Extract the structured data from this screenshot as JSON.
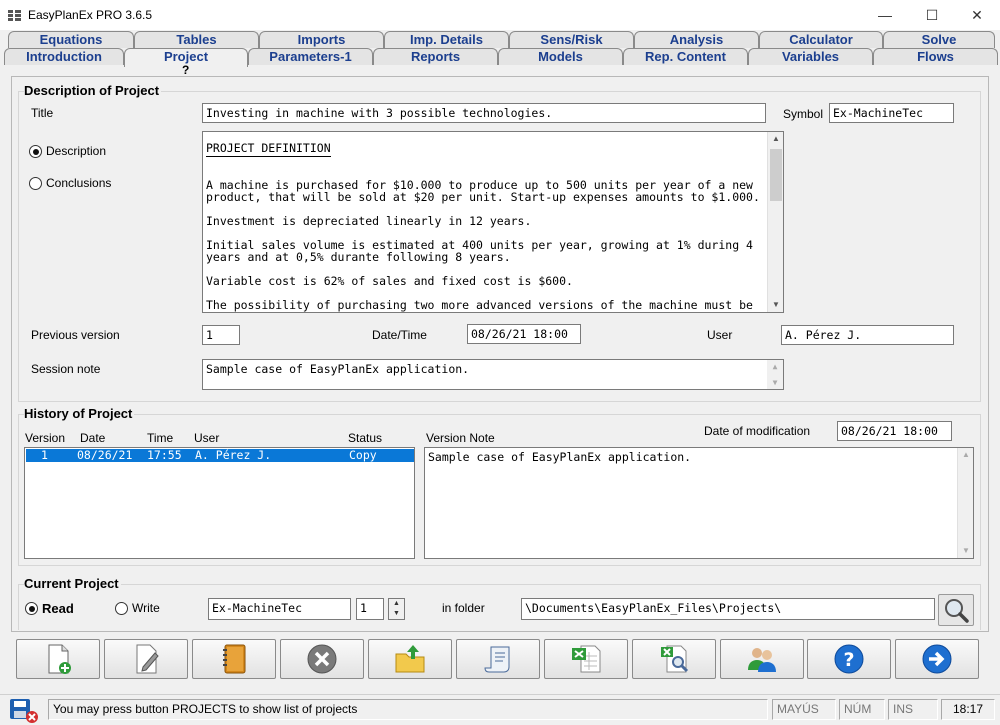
{
  "window": {
    "title": "EasyPlanEx PRO  3.6.5",
    "minimize": "—",
    "maximize": "☐",
    "close": "✕"
  },
  "tabs_row1": [
    "Equations",
    "Tables",
    "Imports",
    "Imp. Details",
    "Sens/Risk",
    "Analysis",
    "Calculator",
    "Solve"
  ],
  "tabs_row2": [
    "Introduction",
    "Project",
    "Parameters-1",
    "Reports",
    "Models",
    "Rep. Content",
    "Variables",
    "Flows"
  ],
  "help_mark": "?",
  "description": {
    "section_title": "Description of Project",
    "title_label": "Title",
    "title_value": "Investing in machine with 3 possible technologies.",
    "symbol_label": "Symbol",
    "symbol_value": "Ex-MachineTec",
    "radio_description": "Description",
    "radio_conclusions": "Conclusions",
    "text_heading": "PROJECT DEFINITION",
    "text_paragraphs": [
      "A machine is purchased for $10.000 to produce up to 500 units per year of a new product, that will be sold at $20 per unit. Start-up expenses amounts to $1.000.",
      "Investment is depreciated linearly in 12 years.",
      "Initial sales volume is estimated at 400 units per year, growing at 1% during 4 years and at 0,5% durante following 8 years.",
      "Variable cost is 62% of sales and fixed cost is $600.",
      "The possibility of purchasing two more advanced versions of the machine must be"
    ],
    "prev_version_label": "Previous version",
    "prev_version_value": "1",
    "datetime_label": "Date/Time",
    "datetime_value": "08/26/21  18:00",
    "user_label": "User",
    "user_value": "A. Pérez J.",
    "session_note_label": "Session note",
    "session_note_value": "Sample case of EasyPlanEx application."
  },
  "history": {
    "section_title": "History of Project",
    "col_version": "Version",
    "col_date": "Date",
    "col_time": "Time",
    "col_user": "User",
    "col_status": "Status",
    "col_note": "Version Note",
    "date_mod_label": "Date of modification",
    "date_mod_value": "08/26/21  18:00",
    "rows": [
      {
        "version": "1",
        "date": "08/26/21",
        "time": "17:55",
        "user": "A. Pérez J.",
        "status": "Copy"
      }
    ],
    "note_text": "Sample case of EasyPlanEx application."
  },
  "current": {
    "section_title": "Current Project",
    "read_label": "Read",
    "write_label": "Write",
    "project_value": "Ex-MachineTec",
    "version_value": "1",
    "folder_label": "in  folder",
    "folder_value": "\\Documents\\EasyPlanEx_Files\\Projects\\"
  },
  "status": {
    "message": "You may press button PROJECTS to show list of projects",
    "caps": "MAYÚS",
    "num": "NÚM",
    "ins": "INS",
    "time": "18:17"
  },
  "colors": {
    "tab_text": "#1c3f8f",
    "selection": "#0a78d7",
    "icon_blue": "#1e6fd0",
    "icon_green": "#2f9b3a"
  }
}
